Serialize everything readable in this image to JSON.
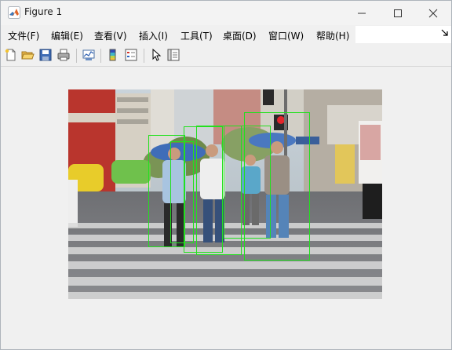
{
  "window": {
    "title": "Figure 1",
    "controls": [
      "minimize-icon",
      "maximize-icon",
      "close-icon"
    ]
  },
  "menu": {
    "items": [
      "文件(F)",
      "编辑(E)",
      "查看(V)",
      "插入(I)",
      "工具(T)",
      "桌面(D)",
      "窗口(W)",
      "帮助(H)"
    ],
    "overflow_icon": "chevron-expand-icon"
  },
  "toolbar": {
    "buttons": [
      "new-figure-icon",
      "open-file-icon",
      "save-icon",
      "print-icon",
      "link-plot-icon",
      "colorbar-icon",
      "legend-icon",
      "edit-pointer-icon",
      "property-inspector-icon"
    ]
  },
  "figure": {
    "image": "street pedestrian crossing photo",
    "detections_count": 5
  }
}
